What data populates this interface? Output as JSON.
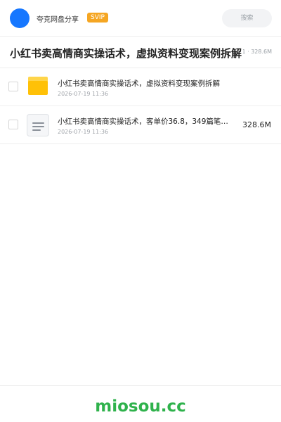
{
  "header": {
    "brand": "夸克网盘分享",
    "badge": "SVIP",
    "search_placeholder": "搜索"
  },
  "share": {
    "title": "小红书卖高情商实操话术，虚拟资料变现案例拆解",
    "meta": "1 · 328.6M"
  },
  "files": [
    {
      "name": "小红书卖高情商实操话术，虚拟资料变现案例拆解",
      "date": "2026-07-19 11:36",
      "size": "",
      "type": "folder"
    },
    {
      "name": "小红书卖高情商实操话术，客单价36.8，349篇笔…",
      "date": "2026-07-19 11:36",
      "size": "328.6M",
      "type": "document"
    }
  ],
  "footer": {
    "brand": "miosou.cc"
  },
  "colors": {
    "accent": "#1677ff",
    "badge": "#f5a623",
    "folder": "#ffc107",
    "footer_brand": "#2fb24c"
  }
}
